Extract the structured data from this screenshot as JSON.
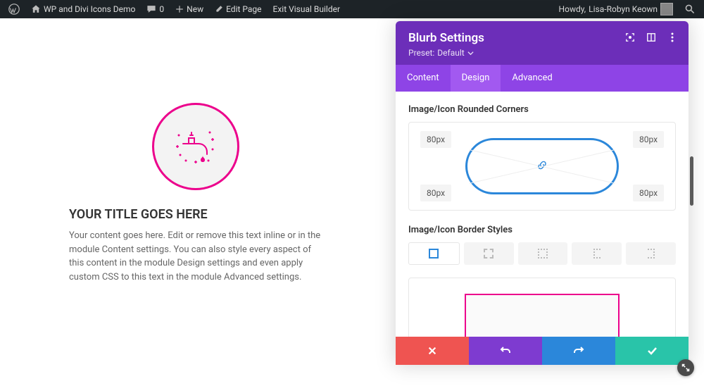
{
  "wpbar": {
    "site_title": "WP and Divi Icons Demo",
    "comments_count": "0",
    "new_label": "New",
    "edit_label": "Edit Page",
    "exit_label": "Exit Visual Builder",
    "howdy_prefix": "Howdy,",
    "user_name": "Lisa-Robyn Keown"
  },
  "blurb": {
    "title": "YOUR TITLE GOES HERE",
    "body": "Your content goes here. Edit or remove this text inline or in the module Content settings. You can also style every aspect of this content in the module Design settings and even apply custom CSS to this text in the module Advanced settings."
  },
  "panel": {
    "title": "Blurb Settings",
    "preset_label": "Preset:",
    "preset_value": "Default",
    "tabs": {
      "content": "Content",
      "design": "Design",
      "advanced": "Advanced",
      "active": "design"
    },
    "section_corners_label": "Image/Icon Rounded Corners",
    "corners": {
      "tl": "80px",
      "tr": "80px",
      "bl": "80px",
      "br": "80px"
    },
    "section_border_label": "Image/Icon Border Styles"
  },
  "colors": {
    "accent_pink": "#ec008c",
    "panel_purple": "#6c2eb9",
    "tab_active": "#a259f0",
    "blue": "#2b87da",
    "green": "#29c4a9",
    "red": "#ef5451"
  }
}
